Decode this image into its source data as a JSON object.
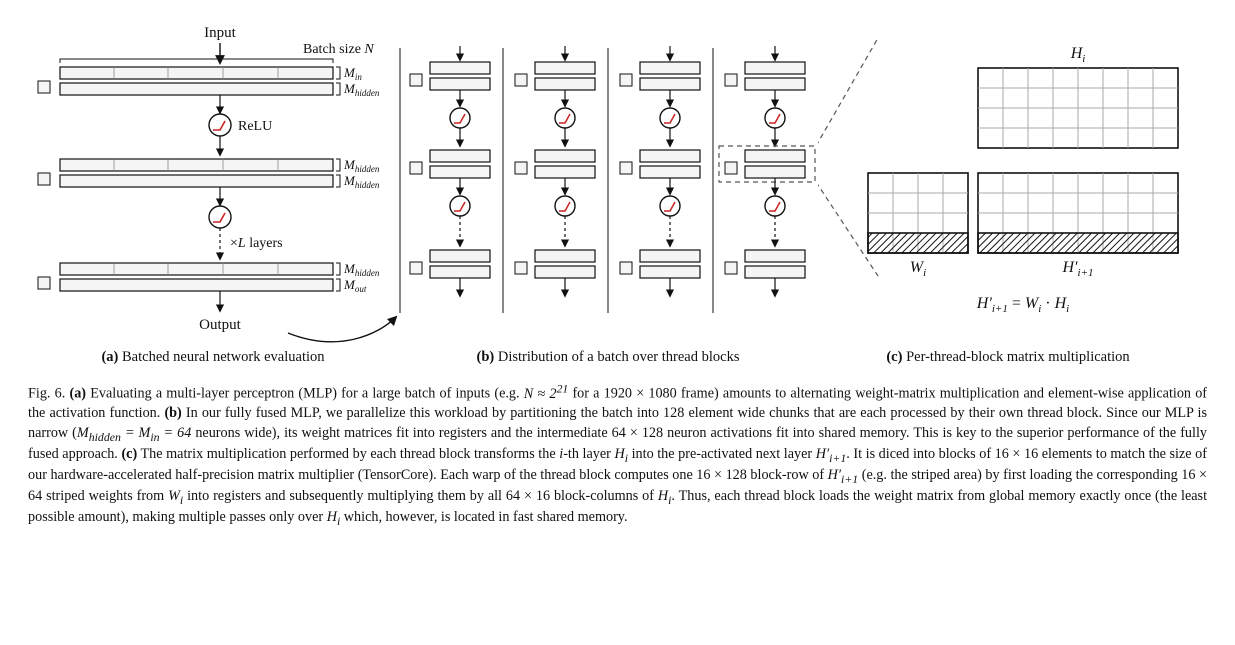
{
  "panel_a": {
    "input_label": "Input",
    "output_label": "Output",
    "batch_label": "Batch size N",
    "M_in": "Min",
    "M_hidden": "Mhidden",
    "M_out": "Mout",
    "relu_label": "ReLU",
    "layers_label": "×L layers"
  },
  "panel_c": {
    "Hi": "Hi",
    "Wi": "Wi",
    "Hip1": "H′i+1",
    "eq": "H′i+1 = Wi · Hi"
  },
  "subcaptions": {
    "a_bold": "(a)",
    "a_text": " Batched neural network evaluation",
    "b_bold": "(b)",
    "b_text": " Distribution of a batch over thread blocks",
    "c_bold": "(c)",
    "c_text": " Per-thread-block matrix multiplication"
  },
  "caption": {
    "fig_label": "Fig. 6.",
    "a_bold": "(a)",
    "a_text_1": " Evaluating a multi-layer perceptron (MLP) for a large batch of inputs (e.g. ",
    "a_eq1": "N ≈ 2",
    "a_exp": "21",
    "a_text_2": " for a 1920 × 1080 frame) amounts to alternating weight-matrix multiplication and element-wise application of the activation function. ",
    "b_bold": "(b)",
    "b_text_1": " In our fully fused MLP, we parallelize this workload by partitioning the batch into 128 element wide chunks that are each processed by their own thread block. Since our MLP is narrow (",
    "b_eq": "Mhidden = Min = 64",
    "b_text_2": " neurons wide), its weight matrices fit into registers and the intermediate 64 × 128 neuron activations fit into shared memory. This is key to the superior performance of the fully fused approach. ",
    "c_bold": "(c)",
    "c_text_1": " The matrix multiplication performed by each thread block transforms the ",
    "c_i": "i",
    "c_text_2": "-th layer ",
    "c_Hi": "Hi",
    "c_text_3": " into the pre-activated next layer ",
    "c_Hip1": "H′i+1",
    "c_text_4": ". It is diced into blocks of 16 × 16 elements to match the size of our hardware-accelerated half-precision matrix multiplier (TensorCore). Each warp of the thread block computes one 16 × 128 block-row of ",
    "c_text_5": " (e.g. the striped area) by first loading the corresponding 16 × 64 striped weights from ",
    "c_Wi": "Wi",
    "c_text_6": " into registers and subsequently multiplying them by all 64 × 16 block-columns of ",
    "c_text_7": ". Thus, each thread block loads the weight matrix from global memory exactly once (the least possible amount), making multiple passes only over ",
    "c_text_8": " which, however, is located in fast shared memory."
  }
}
